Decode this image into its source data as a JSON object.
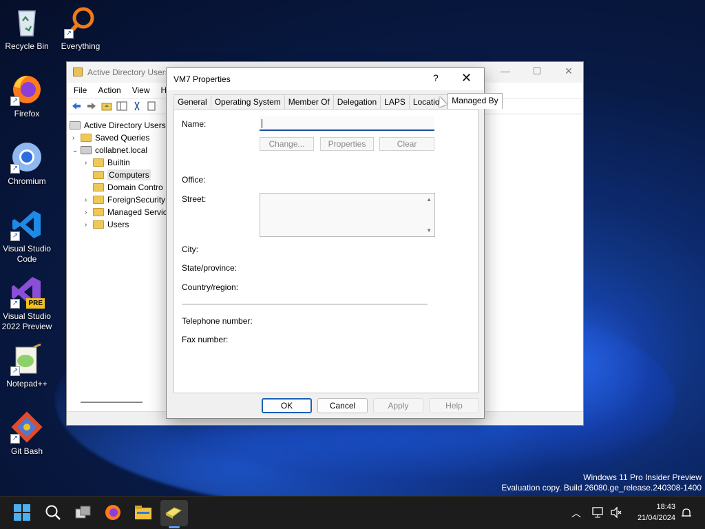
{
  "desktop": {
    "icons": [
      {
        "label": "Recycle Bin"
      },
      {
        "label": "Everything"
      },
      {
        "label": "Firefox"
      },
      {
        "label": "Chromium"
      },
      {
        "label": "Visual Studio Code"
      },
      {
        "label": "Visual Studio 2022 Preview",
        "badge": "PRE"
      },
      {
        "label": "Notepad++"
      },
      {
        "label": "Git Bash"
      }
    ]
  },
  "aduc_window": {
    "title": "Active Directory Users",
    "menu": [
      "File",
      "Action",
      "View",
      "H"
    ],
    "tree": [
      {
        "label": "Active Directory Users a"
      },
      {
        "label": "Saved Queries"
      },
      {
        "label": "collabnet.local"
      },
      {
        "label": "Builtin"
      },
      {
        "label": "Computers"
      },
      {
        "label": "Domain Contro"
      },
      {
        "label": "ForeignSecurity"
      },
      {
        "label": "Managed Servic"
      },
      {
        "label": "Users"
      }
    ]
  },
  "dialog": {
    "title": "VM7 Properties",
    "help_glyph": "?",
    "close_glyph": "✕",
    "tabs": [
      "General",
      "Operating System",
      "Member Of",
      "Delegation",
      "LAPS",
      "Location",
      "Managed By"
    ],
    "active_tab": "Managed By",
    "fields": {
      "name_label": "Name:",
      "name_value": "",
      "change_button": "Change...",
      "properties_button": "Properties",
      "clear_button": "Clear",
      "office_label": "Office:",
      "street_label": "Street:",
      "city_label": "City:",
      "state_label": "State/province:",
      "country_label": "Country/region:",
      "telephone_label": "Telephone number:",
      "fax_label": "Fax number:"
    },
    "buttons": {
      "ok": "OK",
      "cancel": "Cancel",
      "apply": "Apply",
      "help": "Help"
    }
  },
  "watermark": {
    "line1": "Windows 11 Pro Insider Preview",
    "line2": "Evaluation copy. Build 26080.ge_release.240308-1400"
  },
  "taskbar": {
    "time": "18:43",
    "date": "21/04/2024"
  }
}
